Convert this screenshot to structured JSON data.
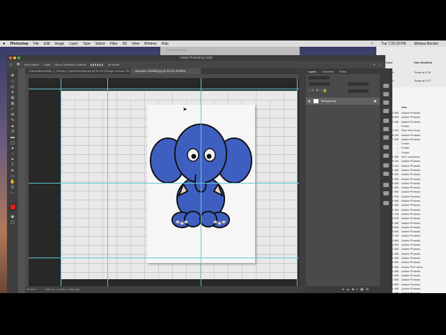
{
  "menubar": {
    "app_name": "Photoshop",
    "items": [
      "File",
      "Edit",
      "Image",
      "Layer",
      "Type",
      "Select",
      "Filter",
      "3D",
      "View",
      "Window",
      "Help"
    ],
    "clock": "Tue 7:22:19 PM",
    "user": "Melissa Bernbe"
  },
  "background_window": {
    "title": "Bill in Windows"
  },
  "ps": {
    "title": "Adobe Photoshop 2020",
    "options": {
      "auto_select": "Auto-Select:",
      "layer_select": "Layer",
      "show_transform": "Show Transform Controls",
      "mode_3d": "3D Mode:"
    },
    "tabs": [
      {
        "label": "CanvasBarnWhite_1_Rhodes_CapiHorizontal.psd @ 33.3% (Design Canvas, RGB/8)"
      },
      {
        "label": "elephant-1269863.jpg @ 33.3% (RGB/8)"
      }
    ],
    "status_left": "33.33%",
    "status_right": "3000 px x 3000 px (300 ppi)",
    "layers_tabs": [
      "Layers",
      "Channels",
      "Paths"
    ],
    "layer_name": "Background"
  },
  "finder": {
    "col_kind": "Kind",
    "col_date": "Date Modified",
    "col_size": "Size",
    "top_rows": [
      {
        "kind": "Folder",
        "date": "Today at 4:25"
      },
      {
        "kind": "Folder",
        "date": "Today at 4:27"
      }
    ],
    "rows": [
      {
        "size": "17.4 MB",
        "kind": "Adobe Photosh"
      },
      {
        "size": "4.6 MB",
        "kind": "Adobe Photosh"
      },
      {
        "size": "5.0 MB",
        "kind": "Adobe Photosh"
      },
      {
        "size": "--",
        "kind": "Folder"
      },
      {
        "size": "4 KB",
        "kind": "Rich Text Docu"
      },
      {
        "size": "336 KB",
        "kind": "Adobe Photosh"
      },
      {
        "size": "7 MB",
        "kind": "Adobe Photosh"
      },
      {
        "size": "--",
        "kind": "Folder"
      },
      {
        "size": "--",
        "kind": "Folder"
      },
      {
        "size": "--",
        "kind": "Folder"
      },
      {
        "size": "95.1 MB",
        "kind": "NLE compress"
      },
      {
        "size": "406 KB",
        "kind": "Adobe Photosh"
      },
      {
        "size": "849 KB",
        "kind": "Adobe Photosh"
      },
      {
        "size": "4.1 MB",
        "kind": "Adobe Photosh"
      },
      {
        "size": "2.5 MB",
        "kind": "Adobe Photosh"
      },
      {
        "size": "1 MB",
        "kind": "Adobe Photosh"
      },
      {
        "size": "1.8 MB",
        "kind": "Adobe Photosh"
      },
      {
        "size": "5.1 MB",
        "kind": "Adobe Photosh"
      },
      {
        "size": "8.7 MB",
        "kind": "Adobe Photosh"
      },
      {
        "size": "860 KB",
        "kind": "Adobe Photosh"
      },
      {
        "size": "4.5 MB",
        "kind": "Adobe Photosh"
      },
      {
        "size": "1.1 MB",
        "kind": "Adobe Photosh"
      },
      {
        "size": "7.1 MB",
        "kind": "Adobe Photosh"
      },
      {
        "size": "697 KB",
        "kind": "Adobe Photosh"
      },
      {
        "size": "838 KB",
        "kind": "Adobe Photosh"
      },
      {
        "size": "6.1 MB",
        "kind": "Adobe Photosh"
      },
      {
        "size": "2.9 MB",
        "kind": "Adobe Photosh"
      },
      {
        "size": "2.8 MB",
        "kind": "Adobe Photosh"
      },
      {
        "size": "925 KB",
        "kind": "Adobe Photosh"
      },
      {
        "size": "23.4 MB",
        "kind": "Adobe Photosh"
      },
      {
        "size": "1.6 MB",
        "kind": "Adobe Photosh"
      },
      {
        "size": "2.2 MB",
        "kind": "Adobe Photosh"
      },
      {
        "size": "4.1 MB",
        "kind": "Adobe Photosh"
      },
      {
        "size": "10.1 MB",
        "kind": "Adobe Photosh"
      },
      {
        "size": "12.5 MB",
        "kind": "Adobe Photosh"
      },
      {
        "size": "2 MB",
        "kind": "Adobe PDF docu"
      },
      {
        "size": "4.1 MB",
        "kind": "Adobe Photosh"
      },
      {
        "size": "1.9 MB",
        "kind": "Adobe Photosh"
      },
      {
        "size": "2 MB",
        "kind": "Adobe Photosh"
      },
      {
        "size": "4.5 MB",
        "kind": "Adobe Photosh"
      },
      {
        "size": "2.1 MB",
        "kind": "Adobe Photosh"
      },
      {
        "size": "2.1 MB",
        "kind": "Adobe Photosh"
      }
    ]
  },
  "colors": {
    "foreground_swatch": "#e02020",
    "background_swatch": "#ffffff",
    "elephant_blue": "#3f5fc0",
    "guide": "#5ec8d8"
  }
}
